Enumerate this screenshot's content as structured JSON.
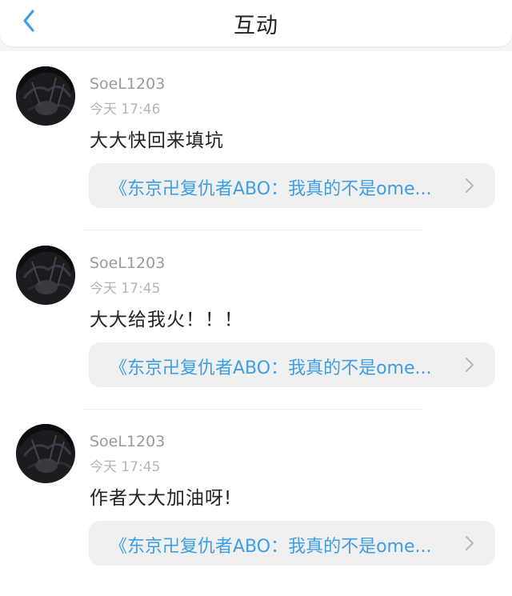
{
  "header": {
    "title": "互动",
    "back_icon": "chevron-left-icon"
  },
  "colors": {
    "accent": "#3d9ee6",
    "link_bg": "#f0f0f1",
    "text": "#222222",
    "muted": "#9a9a9a"
  },
  "comments": [
    {
      "username": "SoeL1203",
      "time": "今天 17:46",
      "text": "大大快回来填坑",
      "work_title": "《东京卍复仇者ABO：我真的不是ome...",
      "link_icon": "chevron-right-icon"
    },
    {
      "username": "SoeL1203",
      "time": "今天 17:45",
      "text": "大大给我火！！！",
      "work_title": "《东京卍复仇者ABO：我真的不是ome...",
      "link_icon": "chevron-right-icon"
    },
    {
      "username": "SoeL1203",
      "time": "今天 17:45",
      "text": "作者大大加油呀!",
      "work_title": "《东京卍复仇者ABO：我真的不是ome...",
      "link_icon": "chevron-right-icon"
    }
  ]
}
